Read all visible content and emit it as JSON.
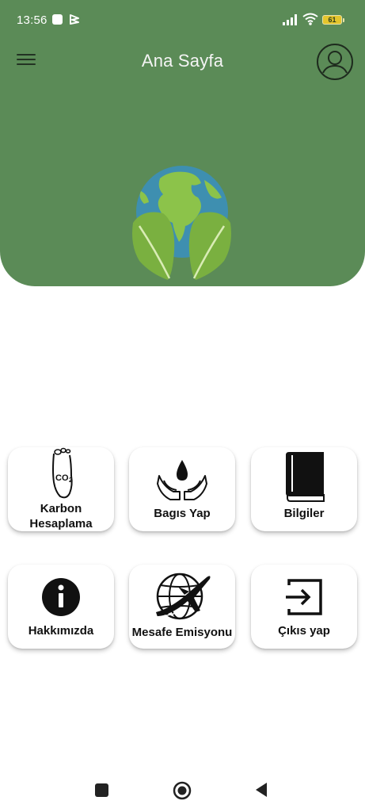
{
  "status_bar": {
    "time": "13:56",
    "battery": "61"
  },
  "header": {
    "title": "Ana Sayfa",
    "background_color": "#5b8b57"
  },
  "icons": {
    "menu": "menu-icon",
    "profile": "profile-icon",
    "logo": "earth-leaves-logo"
  },
  "cards": [
    {
      "label": "Karbon Hesaplama",
      "icon": "co2-footprint-icon"
    },
    {
      "label": "Bagıs Yap",
      "icon": "donate-hands-icon"
    },
    {
      "label": "Bilgiler",
      "icon": "book-icon"
    },
    {
      "label": "Hakkımızda",
      "icon": "info-icon"
    },
    {
      "label": "Mesafe Emisyonu",
      "icon": "globe-plane-icon"
    },
    {
      "label": "Çıkıs yap",
      "icon": "logout-icon"
    }
  ],
  "nav": {
    "items": [
      "recent-apps",
      "home",
      "back"
    ]
  }
}
